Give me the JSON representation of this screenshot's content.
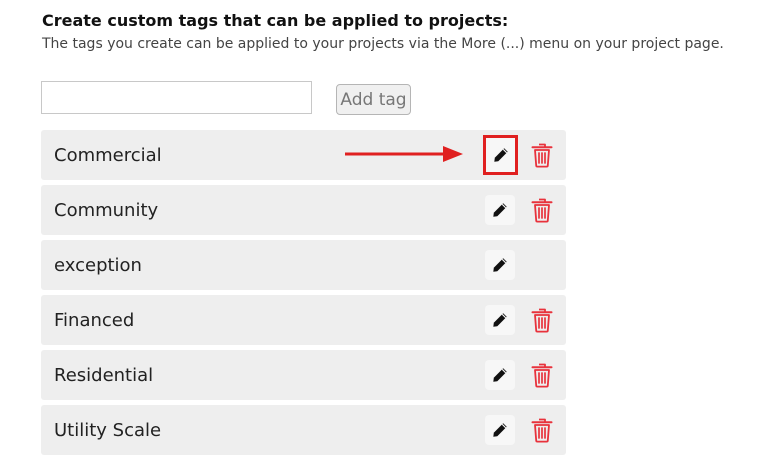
{
  "header": {
    "title": "Create custom tags that can be applied to projects:",
    "description": "The tags you create can be applied to your projects via the More (...) menu on your project page."
  },
  "new_tag": {
    "value": "",
    "placeholder": "",
    "add_button_label": "Add tag"
  },
  "tags": [
    {
      "name": "Commercial",
      "editable": true,
      "deletable": true,
      "highlighted": true
    },
    {
      "name": "Community",
      "editable": true,
      "deletable": true,
      "highlighted": false
    },
    {
      "name": "exception",
      "editable": true,
      "deletable": false,
      "highlighted": false
    },
    {
      "name": "Financed",
      "editable": true,
      "deletable": true,
      "highlighted": false
    },
    {
      "name": "Residential",
      "editable": true,
      "deletable": true,
      "highlighted": false
    },
    {
      "name": "Utility Scale",
      "editable": true,
      "deletable": true,
      "highlighted": false
    }
  ],
  "icons": {
    "edit": "pencil-icon",
    "delete": "trash-icon",
    "annotation": "arrow-right-icon"
  },
  "colors": {
    "delete_icon": "#e8323c",
    "highlight": "#e02020",
    "row_background": "#eeeeee"
  }
}
